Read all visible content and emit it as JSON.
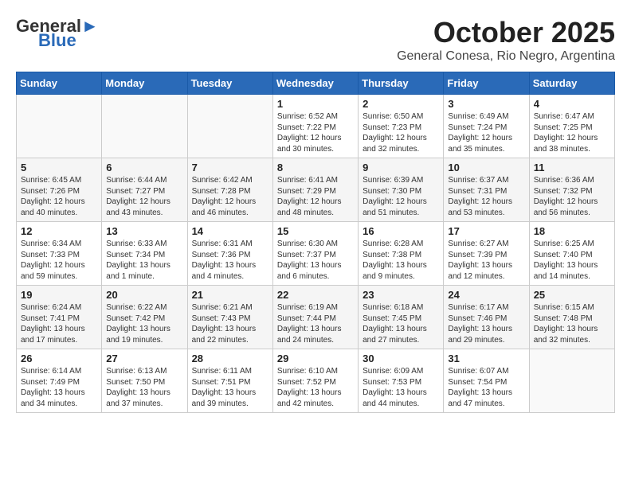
{
  "logo": {
    "general": "General",
    "blue": "Blue"
  },
  "header": {
    "month": "October 2025",
    "location": "General Conesa, Rio Negro, Argentina"
  },
  "weekdays": [
    "Sunday",
    "Monday",
    "Tuesday",
    "Wednesday",
    "Thursday",
    "Friday",
    "Saturday"
  ],
  "weeks": [
    [
      {
        "day": "",
        "info": ""
      },
      {
        "day": "",
        "info": ""
      },
      {
        "day": "",
        "info": ""
      },
      {
        "day": "1",
        "info": "Sunrise: 6:52 AM\nSunset: 7:22 PM\nDaylight: 12 hours\nand 30 minutes."
      },
      {
        "day": "2",
        "info": "Sunrise: 6:50 AM\nSunset: 7:23 PM\nDaylight: 12 hours\nand 32 minutes."
      },
      {
        "day": "3",
        "info": "Sunrise: 6:49 AM\nSunset: 7:24 PM\nDaylight: 12 hours\nand 35 minutes."
      },
      {
        "day": "4",
        "info": "Sunrise: 6:47 AM\nSunset: 7:25 PM\nDaylight: 12 hours\nand 38 minutes."
      }
    ],
    [
      {
        "day": "5",
        "info": "Sunrise: 6:45 AM\nSunset: 7:26 PM\nDaylight: 12 hours\nand 40 minutes."
      },
      {
        "day": "6",
        "info": "Sunrise: 6:44 AM\nSunset: 7:27 PM\nDaylight: 12 hours\nand 43 minutes."
      },
      {
        "day": "7",
        "info": "Sunrise: 6:42 AM\nSunset: 7:28 PM\nDaylight: 12 hours\nand 46 minutes."
      },
      {
        "day": "8",
        "info": "Sunrise: 6:41 AM\nSunset: 7:29 PM\nDaylight: 12 hours\nand 48 minutes."
      },
      {
        "day": "9",
        "info": "Sunrise: 6:39 AM\nSunset: 7:30 PM\nDaylight: 12 hours\nand 51 minutes."
      },
      {
        "day": "10",
        "info": "Sunrise: 6:37 AM\nSunset: 7:31 PM\nDaylight: 12 hours\nand 53 minutes."
      },
      {
        "day": "11",
        "info": "Sunrise: 6:36 AM\nSunset: 7:32 PM\nDaylight: 12 hours\nand 56 minutes."
      }
    ],
    [
      {
        "day": "12",
        "info": "Sunrise: 6:34 AM\nSunset: 7:33 PM\nDaylight: 12 hours\nand 59 minutes."
      },
      {
        "day": "13",
        "info": "Sunrise: 6:33 AM\nSunset: 7:34 PM\nDaylight: 13 hours\nand 1 minute."
      },
      {
        "day": "14",
        "info": "Sunrise: 6:31 AM\nSunset: 7:36 PM\nDaylight: 13 hours\nand 4 minutes."
      },
      {
        "day": "15",
        "info": "Sunrise: 6:30 AM\nSunset: 7:37 PM\nDaylight: 13 hours\nand 6 minutes."
      },
      {
        "day": "16",
        "info": "Sunrise: 6:28 AM\nSunset: 7:38 PM\nDaylight: 13 hours\nand 9 minutes."
      },
      {
        "day": "17",
        "info": "Sunrise: 6:27 AM\nSunset: 7:39 PM\nDaylight: 13 hours\nand 12 minutes."
      },
      {
        "day": "18",
        "info": "Sunrise: 6:25 AM\nSunset: 7:40 PM\nDaylight: 13 hours\nand 14 minutes."
      }
    ],
    [
      {
        "day": "19",
        "info": "Sunrise: 6:24 AM\nSunset: 7:41 PM\nDaylight: 13 hours\nand 17 minutes."
      },
      {
        "day": "20",
        "info": "Sunrise: 6:22 AM\nSunset: 7:42 PM\nDaylight: 13 hours\nand 19 minutes."
      },
      {
        "day": "21",
        "info": "Sunrise: 6:21 AM\nSunset: 7:43 PM\nDaylight: 13 hours\nand 22 minutes."
      },
      {
        "day": "22",
        "info": "Sunrise: 6:19 AM\nSunset: 7:44 PM\nDaylight: 13 hours\nand 24 minutes."
      },
      {
        "day": "23",
        "info": "Sunrise: 6:18 AM\nSunset: 7:45 PM\nDaylight: 13 hours\nand 27 minutes."
      },
      {
        "day": "24",
        "info": "Sunrise: 6:17 AM\nSunset: 7:46 PM\nDaylight: 13 hours\nand 29 minutes."
      },
      {
        "day": "25",
        "info": "Sunrise: 6:15 AM\nSunset: 7:48 PM\nDaylight: 13 hours\nand 32 minutes."
      }
    ],
    [
      {
        "day": "26",
        "info": "Sunrise: 6:14 AM\nSunset: 7:49 PM\nDaylight: 13 hours\nand 34 minutes."
      },
      {
        "day": "27",
        "info": "Sunrise: 6:13 AM\nSunset: 7:50 PM\nDaylight: 13 hours\nand 37 minutes."
      },
      {
        "day": "28",
        "info": "Sunrise: 6:11 AM\nSunset: 7:51 PM\nDaylight: 13 hours\nand 39 minutes."
      },
      {
        "day": "29",
        "info": "Sunrise: 6:10 AM\nSunset: 7:52 PM\nDaylight: 13 hours\nand 42 minutes."
      },
      {
        "day": "30",
        "info": "Sunrise: 6:09 AM\nSunset: 7:53 PM\nDaylight: 13 hours\nand 44 minutes."
      },
      {
        "day": "31",
        "info": "Sunrise: 6:07 AM\nSunset: 7:54 PM\nDaylight: 13 hours\nand 47 minutes."
      },
      {
        "day": "",
        "info": ""
      }
    ]
  ]
}
